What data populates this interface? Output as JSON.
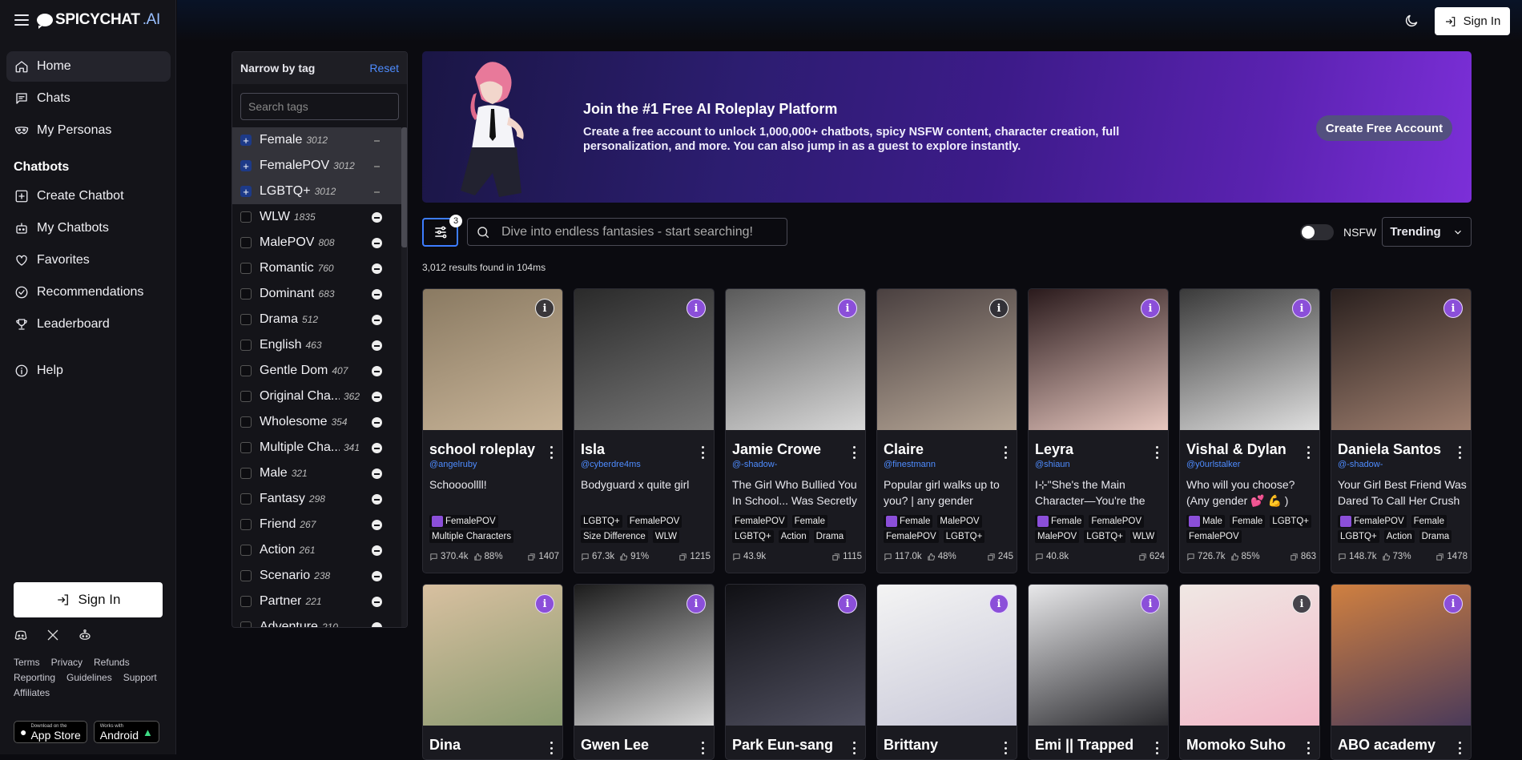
{
  "brand": {
    "name": "SPICYCHAT",
    "suffix": ".AI"
  },
  "nav": {
    "items": [
      {
        "label": "Home",
        "icon": "home-icon",
        "active": true
      },
      {
        "label": "Chats",
        "icon": "chat-icon"
      },
      {
        "label": "My Personas",
        "icon": "mask-icon"
      }
    ],
    "section_title": "Chatbots",
    "chatbot_items": [
      {
        "label": "Create Chatbot",
        "icon": "plus-square-icon"
      },
      {
        "label": "My Chatbots",
        "icon": "robot-icon"
      },
      {
        "label": "Favorites",
        "icon": "heart-icon"
      },
      {
        "label": "Recommendations",
        "icon": "check-circle-icon"
      },
      {
        "label": "Leaderboard",
        "icon": "trophy-icon"
      }
    ],
    "help": "Help"
  },
  "sidebar_signin": "Sign In",
  "footer_links": [
    "Terms",
    "Privacy",
    "Refunds",
    "Reporting",
    "Guidelines",
    "Support",
    "Affiliates"
  ],
  "stores": {
    "appstore_small": "Download on the",
    "appstore_big": "App Store",
    "android_small": "Works with",
    "android_big": "Android"
  },
  "top_signin": "Sign In",
  "tags_panel": {
    "title": "Narrow by tag",
    "reset": "Reset",
    "search_placeholder": "Search tags",
    "tags": [
      {
        "name": "Female",
        "count": "3012",
        "selected": true
      },
      {
        "name": "FemalePOV",
        "count": "3012",
        "selected": true
      },
      {
        "name": "LGBTQ+",
        "count": "3012",
        "selected": true
      },
      {
        "name": "WLW",
        "count": "1835"
      },
      {
        "name": "MalePOV",
        "count": "808"
      },
      {
        "name": "Romantic",
        "count": "760"
      },
      {
        "name": "Dominant",
        "count": "683"
      },
      {
        "name": "Drama",
        "count": "512"
      },
      {
        "name": "English",
        "count": "463"
      },
      {
        "name": "Gentle Dom",
        "count": "407"
      },
      {
        "name": "Original Cha...",
        "count": "362"
      },
      {
        "name": "Wholesome",
        "count": "354"
      },
      {
        "name": "Multiple Cha...",
        "count": "341"
      },
      {
        "name": "Male",
        "count": "321"
      },
      {
        "name": "Fantasy",
        "count": "298"
      },
      {
        "name": "Friend",
        "count": "267"
      },
      {
        "name": "Action",
        "count": "261"
      },
      {
        "name": "Scenario",
        "count": "238"
      },
      {
        "name": "Partner",
        "count": "221"
      },
      {
        "name": "Adventure",
        "count": "210"
      }
    ]
  },
  "banner": {
    "title": "Join the #1 Free AI Roleplay Platform",
    "text": "Create a free account to unlock 1,000,000+ chatbots, spicy NSFW content, character creation, full personalization, and more. You can also jump in as a guest to explore instantly.",
    "cta": "Create Free Account"
  },
  "filter_badge": "3",
  "search_placeholder": "Dive into endless fantasies - start searching!",
  "nsfw_label": "NSFW",
  "sort_label": "Trending",
  "results_text": "3,012 results found in 104ms",
  "cards": [
    {
      "name": "school roleplay",
      "author": "@angelruby",
      "desc": "Schoooollll!",
      "tags": [
        "FemalePOV",
        "Multiple Characters"
      ],
      "pm": [
        true,
        false
      ],
      "chats": "370.4k",
      "likes": "88%",
      "msgs": "1407",
      "thumb": [
        "#8a7a62",
        "#c8b498"
      ],
      "info": "dark"
    },
    {
      "name": "Isla",
      "author": "@cyberdre4ms",
      "desc": "Bodyguard x quite girl",
      "tags": [
        "LGBTQ+",
        "FemalePOV",
        "Size Difference",
        "WLW"
      ],
      "pm": [
        false,
        false,
        false,
        false
      ],
      "chats": "67.3k",
      "likes": "91%",
      "msgs": "1215",
      "thumb": [
        "#2a2a2a",
        "#777777"
      ],
      "info": "purple"
    },
    {
      "name": "Jamie Crowe",
      "author": "@-shadow-",
      "desc": "The Girl Who Bullied You In School... Was Secretly in love",
      "tags": [
        "FemalePOV",
        "Female",
        "LGBTQ+",
        "Action",
        "Drama"
      ],
      "pm": [
        false,
        false,
        false,
        false,
        false
      ],
      "chats": "43.9k",
      "likes": "",
      "msgs": "1115",
      "thumb": [
        "#5a5a5a",
        "#d8d8d8"
      ],
      "info": "purple"
    },
    {
      "name": "Claire",
      "author": "@finestmann",
      "desc": "Popular girl walks up to you? | any gender",
      "tags": [
        "Female",
        "MalePOV",
        "FemalePOV",
        "LGBTQ+"
      ],
      "pm": [
        true,
        false,
        false,
        false
      ],
      "chats": "117.0k",
      "likes": "48%",
      "msgs": "245",
      "thumb": [
        "#4a4040",
        "#b8a898"
      ],
      "info": "dark"
    },
    {
      "name": "Leyra",
      "author": "@shiaun",
      "desc": "I⊹\"She's the Main Character—You're the side one\"",
      "tags": [
        "Female",
        "FemalePOV",
        "MalePOV",
        "LGBTQ+",
        "WLW"
      ],
      "pm": [
        true,
        false,
        false,
        false,
        false
      ],
      "chats": "40.8k",
      "likes": "",
      "msgs": "624",
      "thumb": [
        "#2a1a1c",
        "#e8c8c0"
      ],
      "info": "purple"
    },
    {
      "name": "Vishal & Dylan",
      "author": "@y0urlstalker",
      "desc": "Who will you choose? (Any gender 💕 💪 )",
      "tags": [
        "Male",
        "Female",
        "LGBTQ+",
        "FemalePOV"
      ],
      "pm": [
        true,
        false,
        false,
        false
      ],
      "chats": "726.7k",
      "likes": "85%",
      "msgs": "863",
      "thumb": [
        "#3a3a3a",
        "#e0e0e0"
      ],
      "info": "purple"
    },
    {
      "name": "Daniela Santos",
      "author": "@-shadow-",
      "desc": "Your Girl Best Friend Was Dared To Call Her Crush",
      "tags": [
        "FemalePOV",
        "Female",
        "LGBTQ+",
        "Action",
        "Drama"
      ],
      "pm": [
        true,
        false,
        false,
        false,
        false
      ],
      "chats": "148.7k",
      "likes": "73%",
      "msgs": "1478",
      "thumb": [
        "#2a201e",
        "#a08070"
      ],
      "info": "purple"
    },
    {
      "name": "Dina",
      "thumb": [
        "#d8c0a0",
        "#8a9a70"
      ],
      "info": "purple"
    },
    {
      "name": "Gwen Lee",
      "thumb": [
        "#1c1c1c",
        "#d8d8d8"
      ],
      "info": "purple"
    },
    {
      "name": "Park Eun-sang",
      "thumb": [
        "#101014",
        "#505060"
      ],
      "info": "purple"
    },
    {
      "name": "Brittany",
      "thumb": [
        "#f4f4f4",
        "#c8c8d8"
      ],
      "info": "purple"
    },
    {
      "name": "Emi || Trapped",
      "thumb": [
        "#e8e8ea",
        "#2a2a2e"
      ],
      "info": "purple"
    },
    {
      "name": "Momoko Suho",
      "thumb": [
        "#f0e8e4",
        "#f2b8c8"
      ],
      "info": "dark"
    },
    {
      "name": "ABO academy",
      "thumb": [
        "#d08040",
        "#4a3a5a"
      ],
      "info": "purple"
    }
  ]
}
